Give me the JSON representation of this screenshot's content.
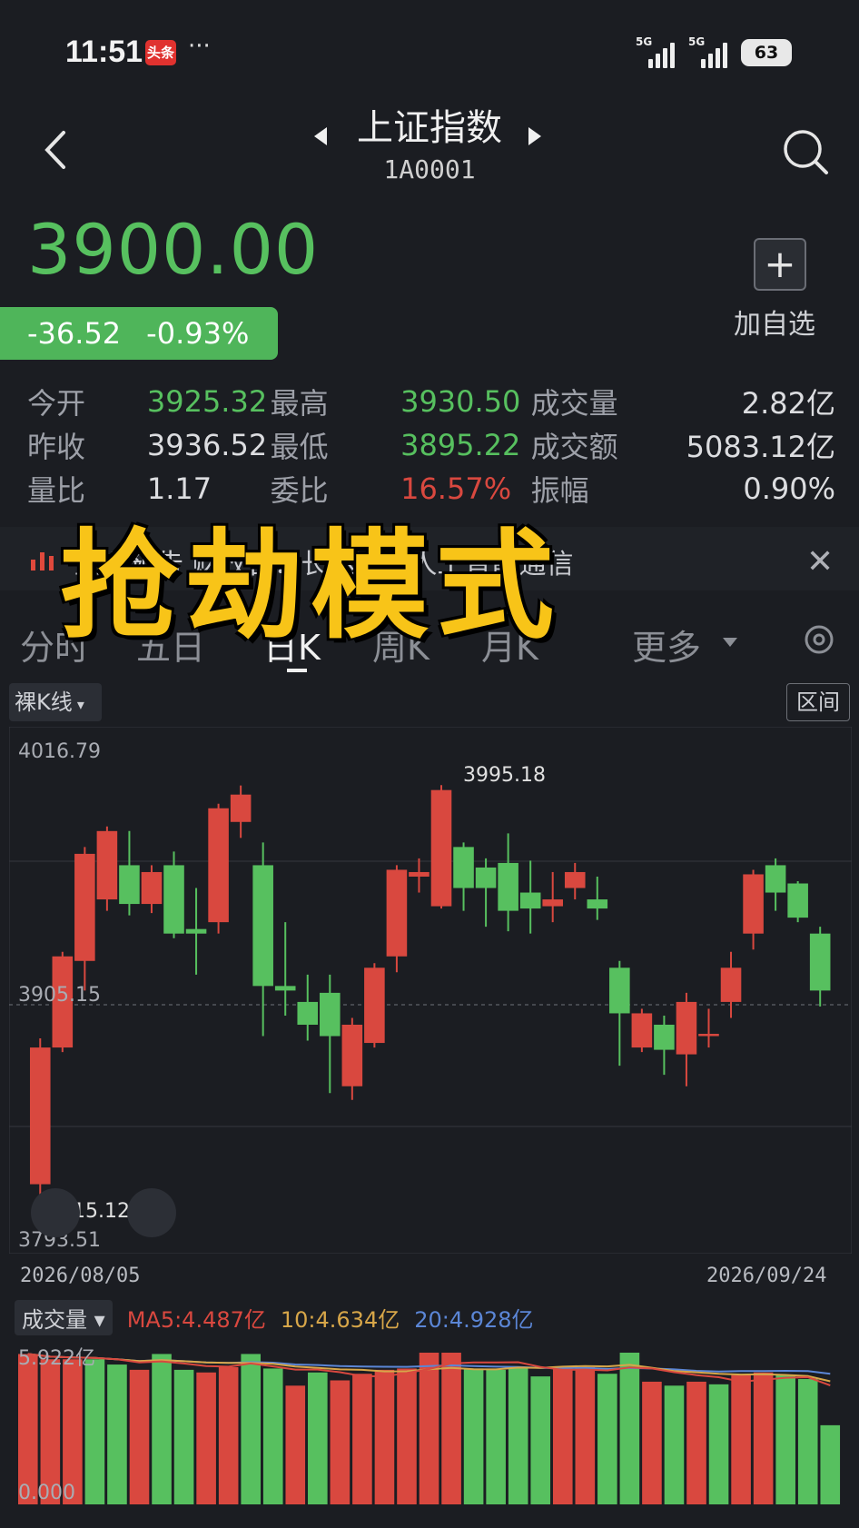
{
  "status": {
    "time": "11:51",
    "app_badge": "头条",
    "dots": "···",
    "net1": "5G",
    "net2": "5G",
    "battery": "63"
  },
  "header": {
    "title": "上证指数",
    "code": "1A0001"
  },
  "quote": {
    "price": "3900.00",
    "change": "-36.52",
    "change_pct": "-0.93%",
    "add_label": "加自选",
    "add_symbol": "+",
    "rows": [
      [
        {
          "label": "今开",
          "value": "3925.32",
          "color": "green"
        },
        {
          "label": "最高",
          "value": "3930.50",
          "color": "green"
        },
        {
          "label": "成交量",
          "value": "2.82亿",
          "color": "white"
        }
      ],
      [
        {
          "label": "昨收",
          "value": "3936.52",
          "color": "white"
        },
        {
          "label": "最低",
          "value": "3895.22",
          "color": "green"
        },
        {
          "label": "成交额",
          "value": "5083.12亿",
          "color": "white"
        }
      ],
      [
        {
          "label": "量比",
          "value": "1.17",
          "color": "white"
        },
        {
          "label": "委比",
          "value": "16.57%",
          "color": "red"
        },
        {
          "label": "振幅",
          "value": "0.90%",
          "color": "white"
        }
      ]
    ]
  },
  "notice": {
    "text": "直播预告 财收官：长达国产人工智能通信"
  },
  "tabs": [
    "分时",
    "五日",
    "日K",
    "周K",
    "月K",
    "更多"
  ],
  "chart": {
    "kline_type": "裸K线",
    "range_label": "区间",
    "y_top_label": "4016.79",
    "y_mid_label": "3905.15",
    "y_bottom_label": "3793.51",
    "high_label": "3995.18",
    "low_label": "3815.12",
    "date_start": "2026/08/05",
    "date_end": "2026/09/24"
  },
  "volume": {
    "button": "成交量",
    "ma5": "MA5:4.487亿",
    "ma10": "10:4.634亿",
    "ma20": "20:4.928亿",
    "top_label": "5.922亿",
    "zero_label": "0.000"
  },
  "overlay": {
    "text": "抢劫模式"
  },
  "colors": {
    "up": "#d9483f",
    "down": "#57c05f",
    "bg": "#1b1d22",
    "accent": "#f8c418"
  },
  "chart_data": {
    "type": "candlestick",
    "ylim": [
      3793.51,
      4016.79
    ],
    "candles": [
      {
        "o": 3820,
        "c": 3880,
        "h": 3884,
        "l": 3815.12
      },
      {
        "o": 3880,
        "c": 3920,
        "h": 3922,
        "l": 3878
      },
      {
        "o": 3918,
        "c": 3965,
        "h": 3968,
        "l": 3905
      },
      {
        "o": 3945,
        "c": 3975,
        "h": 3977,
        "l": 3940
      },
      {
        "o": 3960,
        "c": 3943,
        "h": 3975,
        "l": 3938
      },
      {
        "o": 3943,
        "c": 3957,
        "h": 3960,
        "l": 3939
      },
      {
        "o": 3960,
        "c": 3930,
        "h": 3966,
        "l": 3928
      },
      {
        "o": 3932,
        "c": 3930,
        "h": 3950,
        "l": 3912
      },
      {
        "o": 3935,
        "c": 3985,
        "h": 3987,
        "l": 3930
      },
      {
        "o": 3979,
        "c": 3991,
        "h": 3995,
        "l": 3972
      },
      {
        "o": 3960,
        "c": 3907,
        "h": 3970,
        "l": 3885
      },
      {
        "o": 3907,
        "c": 3905,
        "h": 3935,
        "l": 3894
      },
      {
        "o": 3900,
        "c": 3890,
        "h": 3912,
        "l": 3883
      },
      {
        "o": 3904,
        "c": 3885,
        "h": 3912,
        "l": 3860
      },
      {
        "o": 3863,
        "c": 3890,
        "h": 3893,
        "l": 3857
      },
      {
        "o": 3882,
        "c": 3915,
        "h": 3917,
        "l": 3880
      },
      {
        "o": 3920,
        "c": 3958,
        "h": 3960,
        "l": 3913
      },
      {
        "o": 3955,
        "c": 3957,
        "h": 3963,
        "l": 3948
      },
      {
        "o": 3942,
        "c": 3993,
        "h": 3995.18,
        "l": 3941
      },
      {
        "o": 3968,
        "c": 3950,
        "h": 3970,
        "l": 3940
      },
      {
        "o": 3959,
        "c": 3950,
        "h": 3963,
        "l": 3933
      },
      {
        "o": 3961,
        "c": 3940,
        "h": 3974,
        "l": 3931
      },
      {
        "o": 3948,
        "c": 3941,
        "h": 3962,
        "l": 3930
      },
      {
        "o": 3942,
        "c": 3945,
        "h": 3957,
        "l": 3935
      },
      {
        "o": 3950,
        "c": 3957,
        "h": 3961,
        "l": 3945
      },
      {
        "o": 3945,
        "c": 3941,
        "h": 3955,
        "l": 3936
      },
      {
        "o": 3915,
        "c": 3895,
        "h": 3918,
        "l": 3872
      },
      {
        "o": 3880,
        "c": 3895,
        "h": 3897,
        "l": 3878
      },
      {
        "o": 3890,
        "c": 3879,
        "h": 3894,
        "l": 3868
      },
      {
        "o": 3877,
        "c": 3900,
        "h": 3904,
        "l": 3863
      },
      {
        "o": 3885,
        "c": 3886,
        "h": 3897,
        "l": 3880
      },
      {
        "o": 3900,
        "c": 3915,
        "h": 3922,
        "l": 3893
      },
      {
        "o": 3930,
        "c": 3956,
        "h": 3958,
        "l": 3923
      },
      {
        "o": 3960,
        "c": 3948,
        "h": 3963,
        "l": 3940
      },
      {
        "o": 3952,
        "c": 3937,
        "h": 3953,
        "l": 3935
      },
      {
        "o": 3930,
        "c": 3905,
        "h": 3933,
        "l": 3898
      }
    ],
    "volume_max": 5.922,
    "volumes": [
      {
        "v": 5.7,
        "up": true
      },
      {
        "v": 5.5,
        "up": true
      },
      {
        "v": 5.5,
        "up": true
      },
      {
        "v": 5.5,
        "up": false
      },
      {
        "v": 5.3,
        "up": false
      },
      {
        "v": 5.1,
        "up": true
      },
      {
        "v": 5.7,
        "up": false
      },
      {
        "v": 5.1,
        "up": false
      },
      {
        "v": 5.0,
        "up": true
      },
      {
        "v": 5.2,
        "up": true
      },
      {
        "v": 5.7,
        "up": false
      },
      {
        "v": 5.15,
        "up": false
      },
      {
        "v": 4.5,
        "up": true
      },
      {
        "v": 5.0,
        "up": false
      },
      {
        "v": 4.7,
        "up": true
      },
      {
        "v": 4.95,
        "up": true
      },
      {
        "v": 5.1,
        "up": true
      },
      {
        "v": 5.15,
        "up": true
      },
      {
        "v": 5.75,
        "up": true
      },
      {
        "v": 5.75,
        "up": true
      },
      {
        "v": 5.15,
        "up": false
      },
      {
        "v": 5.1,
        "up": false
      },
      {
        "v": 5.2,
        "up": false
      },
      {
        "v": 4.85,
        "up": false
      },
      {
        "v": 5.2,
        "up": true
      },
      {
        "v": 5.2,
        "up": true
      },
      {
        "v": 4.95,
        "up": false
      },
      {
        "v": 5.75,
        "up": false
      },
      {
        "v": 4.65,
        "up": true
      },
      {
        "v": 4.5,
        "up": false
      },
      {
        "v": 4.65,
        "up": true
      },
      {
        "v": 4.55,
        "up": false
      },
      {
        "v": 4.9,
        "up": true
      },
      {
        "v": 5.0,
        "up": true
      },
      {
        "v": 4.9,
        "up": false
      },
      {
        "v": 4.75,
        "up": false
      },
      {
        "v": 3.0,
        "up": false
      }
    ]
  }
}
